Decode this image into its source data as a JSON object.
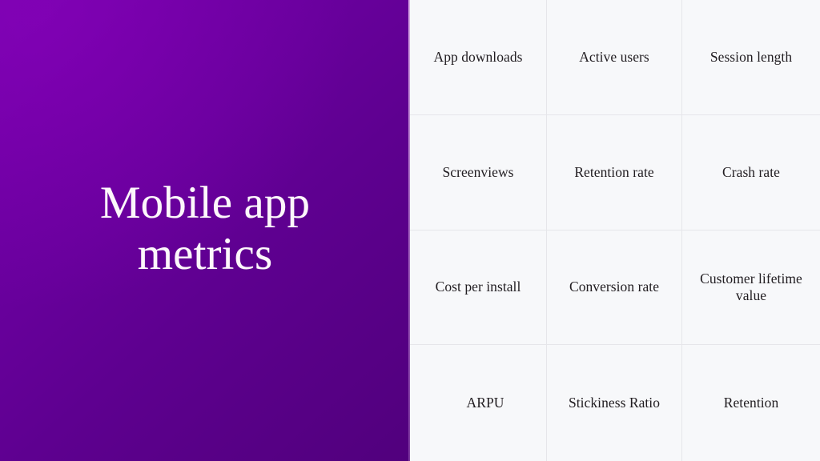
{
  "slide": {
    "title": "Mobile app\nmetrics",
    "title_line_1": "Mobile app",
    "title_line_2": "metrics",
    "layout": "two-column-title-and-grid",
    "colors": {
      "panel_gradient_start": "#7404ab",
      "panel_gradient_end": "#51007d",
      "panel_highlight": "#8c00be",
      "panel_edge_line": "#f0cdf5",
      "grid_background": "#f7f8fa",
      "grid_line": "#e6e6ea",
      "title_text": "#fdf7fb",
      "cell_text": "#211d21"
    }
  },
  "metrics_grid": {
    "columns": 3,
    "rows": 4,
    "cells": [
      {
        "label": "App downloads"
      },
      {
        "label": "Active users"
      },
      {
        "label": "Session length"
      },
      {
        "label": "Screenviews"
      },
      {
        "label": "Retention rate"
      },
      {
        "label": "Crash rate"
      },
      {
        "label": "Cost per install"
      },
      {
        "label": "Conversion rate"
      },
      {
        "label": "Customer lifetime value"
      },
      {
        "label": "ARPU"
      },
      {
        "label": "Stickiness Ratio"
      },
      {
        "label": "Retention"
      }
    ]
  }
}
